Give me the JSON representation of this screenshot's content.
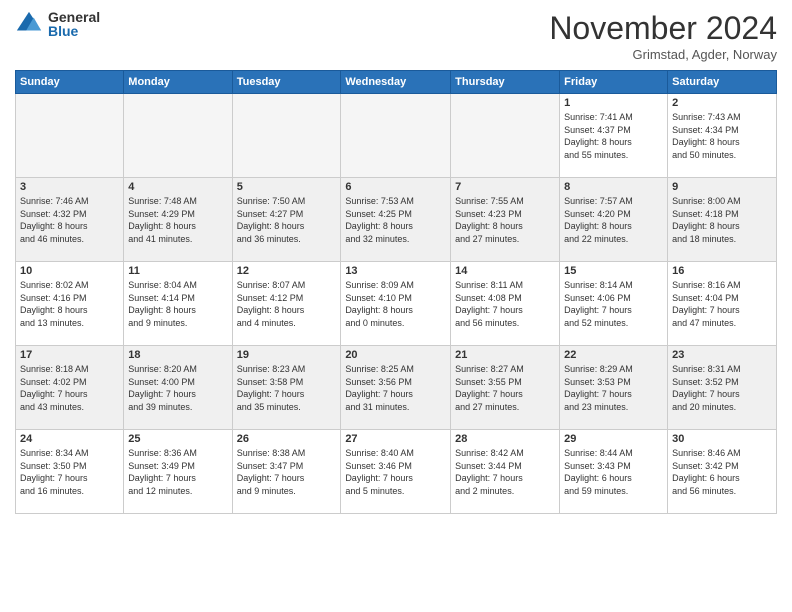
{
  "logo": {
    "general": "General",
    "blue": "Blue"
  },
  "title": "November 2024",
  "subtitle": "Grimstad, Agder, Norway",
  "headers": [
    "Sunday",
    "Monday",
    "Tuesday",
    "Wednesday",
    "Thursday",
    "Friday",
    "Saturday"
  ],
  "weeks": [
    [
      {
        "day": "",
        "info": ""
      },
      {
        "day": "",
        "info": ""
      },
      {
        "day": "",
        "info": ""
      },
      {
        "day": "",
        "info": ""
      },
      {
        "day": "",
        "info": ""
      },
      {
        "day": "1",
        "info": "Sunrise: 7:41 AM\nSunset: 4:37 PM\nDaylight: 8 hours\nand 55 minutes."
      },
      {
        "day": "2",
        "info": "Sunrise: 7:43 AM\nSunset: 4:34 PM\nDaylight: 8 hours\nand 50 minutes."
      }
    ],
    [
      {
        "day": "3",
        "info": "Sunrise: 7:46 AM\nSunset: 4:32 PM\nDaylight: 8 hours\nand 46 minutes."
      },
      {
        "day": "4",
        "info": "Sunrise: 7:48 AM\nSunset: 4:29 PM\nDaylight: 8 hours\nand 41 minutes."
      },
      {
        "day": "5",
        "info": "Sunrise: 7:50 AM\nSunset: 4:27 PM\nDaylight: 8 hours\nand 36 minutes."
      },
      {
        "day": "6",
        "info": "Sunrise: 7:53 AM\nSunset: 4:25 PM\nDaylight: 8 hours\nand 32 minutes."
      },
      {
        "day": "7",
        "info": "Sunrise: 7:55 AM\nSunset: 4:23 PM\nDaylight: 8 hours\nand 27 minutes."
      },
      {
        "day": "8",
        "info": "Sunrise: 7:57 AM\nSunset: 4:20 PM\nDaylight: 8 hours\nand 22 minutes."
      },
      {
        "day": "9",
        "info": "Sunrise: 8:00 AM\nSunset: 4:18 PM\nDaylight: 8 hours\nand 18 minutes."
      }
    ],
    [
      {
        "day": "10",
        "info": "Sunrise: 8:02 AM\nSunset: 4:16 PM\nDaylight: 8 hours\nand 13 minutes."
      },
      {
        "day": "11",
        "info": "Sunrise: 8:04 AM\nSunset: 4:14 PM\nDaylight: 8 hours\nand 9 minutes."
      },
      {
        "day": "12",
        "info": "Sunrise: 8:07 AM\nSunset: 4:12 PM\nDaylight: 8 hours\nand 4 minutes."
      },
      {
        "day": "13",
        "info": "Sunrise: 8:09 AM\nSunset: 4:10 PM\nDaylight: 8 hours\nand 0 minutes."
      },
      {
        "day": "14",
        "info": "Sunrise: 8:11 AM\nSunset: 4:08 PM\nDaylight: 7 hours\nand 56 minutes."
      },
      {
        "day": "15",
        "info": "Sunrise: 8:14 AM\nSunset: 4:06 PM\nDaylight: 7 hours\nand 52 minutes."
      },
      {
        "day": "16",
        "info": "Sunrise: 8:16 AM\nSunset: 4:04 PM\nDaylight: 7 hours\nand 47 minutes."
      }
    ],
    [
      {
        "day": "17",
        "info": "Sunrise: 8:18 AM\nSunset: 4:02 PM\nDaylight: 7 hours\nand 43 minutes."
      },
      {
        "day": "18",
        "info": "Sunrise: 8:20 AM\nSunset: 4:00 PM\nDaylight: 7 hours\nand 39 minutes."
      },
      {
        "day": "19",
        "info": "Sunrise: 8:23 AM\nSunset: 3:58 PM\nDaylight: 7 hours\nand 35 minutes."
      },
      {
        "day": "20",
        "info": "Sunrise: 8:25 AM\nSunset: 3:56 PM\nDaylight: 7 hours\nand 31 minutes."
      },
      {
        "day": "21",
        "info": "Sunrise: 8:27 AM\nSunset: 3:55 PM\nDaylight: 7 hours\nand 27 minutes."
      },
      {
        "day": "22",
        "info": "Sunrise: 8:29 AM\nSunset: 3:53 PM\nDaylight: 7 hours\nand 23 minutes."
      },
      {
        "day": "23",
        "info": "Sunrise: 8:31 AM\nSunset: 3:52 PM\nDaylight: 7 hours\nand 20 minutes."
      }
    ],
    [
      {
        "day": "24",
        "info": "Sunrise: 8:34 AM\nSunset: 3:50 PM\nDaylight: 7 hours\nand 16 minutes."
      },
      {
        "day": "25",
        "info": "Sunrise: 8:36 AM\nSunset: 3:49 PM\nDaylight: 7 hours\nand 12 minutes."
      },
      {
        "day": "26",
        "info": "Sunrise: 8:38 AM\nSunset: 3:47 PM\nDaylight: 7 hours\nand 9 minutes."
      },
      {
        "day": "27",
        "info": "Sunrise: 8:40 AM\nSunset: 3:46 PM\nDaylight: 7 hours\nand 5 minutes."
      },
      {
        "day": "28",
        "info": "Sunrise: 8:42 AM\nSunset: 3:44 PM\nDaylight: 7 hours\nand 2 minutes."
      },
      {
        "day": "29",
        "info": "Sunrise: 8:44 AM\nSunset: 3:43 PM\nDaylight: 6 hours\nand 59 minutes."
      },
      {
        "day": "30",
        "info": "Sunrise: 8:46 AM\nSunset: 3:42 PM\nDaylight: 6 hours\nand 56 minutes."
      }
    ]
  ]
}
